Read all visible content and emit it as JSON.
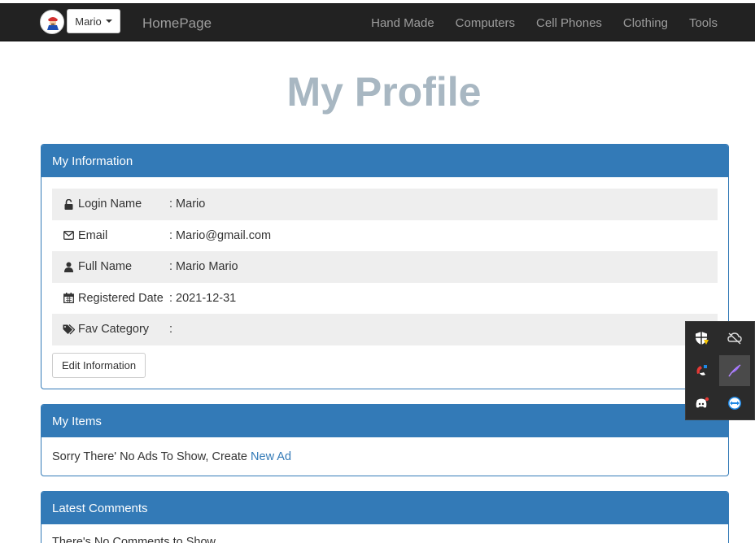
{
  "navbar": {
    "user_label": "Mario",
    "brand": "HomePage",
    "links": [
      "Hand Made",
      "Computers",
      "Cell Phones",
      "Clothing",
      "Tools"
    ]
  },
  "page_title": "My Profile",
  "info_panel": {
    "title": "My Information",
    "rows": [
      {
        "icon": "unlock-icon",
        "label": "Login Name",
        "value": ": Mario"
      },
      {
        "icon": "envelope-icon",
        "label": "Email",
        "value": ": Mario@gmail.com"
      },
      {
        "icon": "user-icon",
        "label": "Full Name",
        "value": ": Mario Mario"
      },
      {
        "icon": "calendar-icon",
        "label": "Registered Date",
        "value": ": 2021-12-31"
      },
      {
        "icon": "tags-icon",
        "label": "Fav Category",
        "value": ":"
      }
    ],
    "edit_button": "Edit Information"
  },
  "items_panel": {
    "title": "My Items",
    "message": "Sorry There' No Ads To Show, Create",
    "link": "New Ad"
  },
  "comments_panel": {
    "title": "Latest Comments",
    "message": "There's No Comments to Show"
  },
  "colors": {
    "primary": "#337ab7",
    "navbar_bg": "#222222",
    "title": "#a8b7c2"
  },
  "tray_icons": [
    "security-shield-icon",
    "cloud-offline-icon",
    "magnet-app-icon",
    "feather-pen-icon",
    "discord-icon",
    "teamviewer-icon"
  ]
}
